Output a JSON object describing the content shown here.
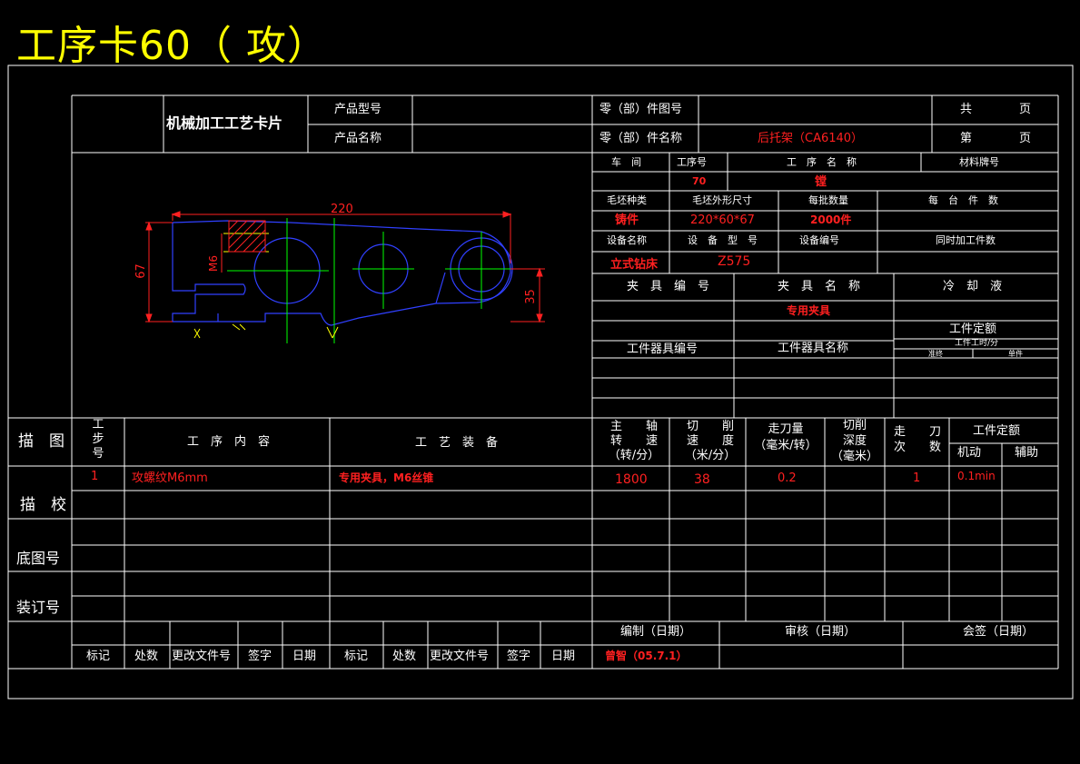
{
  "title": "工序卡60（ 攻）",
  "header": {
    "card_title": "机械加工工艺卡片",
    "product_model_label": "产品型号",
    "product_name_label": "产品名称",
    "part_no_label": "零（部）件图号",
    "part_name_label": "零（部）件名称",
    "part_name_value": "后托架（CA6140）",
    "total_label": "共",
    "page_label": "页",
    "sheet_label": "第",
    "sheet_page_label": "页"
  },
  "info": {
    "workshop_label": "车　间",
    "process_no_label": "工序号",
    "process_name_label": "工　序　名　称",
    "material_label": "材料牌号",
    "process_no_value": "70",
    "process_name_value": "镗",
    "blank_type_label": "毛坯种类",
    "blank_size_label": "毛坯外形尺寸",
    "batch_label": "每批数量",
    "per_unit_label": "每　台　件　数",
    "blank_type_value": "铸件",
    "blank_size_value": "220*60*67",
    "batch_value": "2000件",
    "equip_name_label": "设备名称",
    "equip_model_label": "设　备　型　号",
    "equip_no_label": "设备编号",
    "simul_label": "同时加工件数",
    "equip_name_value": "立式钻床",
    "equip_model_value": "Z575",
    "fixture_no_label": "夹　具　编　号",
    "fixture_name_label": "夹　具　名　称",
    "coolant_label": "冷　却　液",
    "fixture_name_value": "专用夹具",
    "quota_label": "工件定额",
    "tool_no_label": "工件器具编号",
    "tool_name_label": "工件器具名称",
    "time_label": "工件工时/分",
    "prep_label": "准终",
    "unit_label": "单件"
  },
  "drawing": {
    "dim_220": "220",
    "dim_67": "67",
    "dim_35": "35",
    "dim_m6": "M6"
  },
  "steps_header": {
    "sketch": "描　图",
    "step_no": "工步号",
    "content": "工　序　内　容",
    "equipment": "工　艺　装　备",
    "spindle": "主　　轴\n转　　速\n（转/分）",
    "cut_speed": "切　　削\n速　　度\n（米/分）",
    "feed": "走刀量\n（毫米/转）",
    "depth": "切削\n深度\n（毫米）",
    "passes": "走　　刀\n次　　数",
    "quota": "工件定额",
    "machine": "机动",
    "aux": "辅助"
  },
  "step1": {
    "no": "1",
    "content": "攻螺纹M6mm",
    "equipment": "专用夹具，M6丝锥",
    "spindle": "1800",
    "speed": "38",
    "feed": "0.2",
    "passes": "1",
    "machine": "0.1min"
  },
  "side": {
    "check": "描　校",
    "base_no": "底图号",
    "binding_no": "装订号"
  },
  "footer": {
    "compile": "编制（日期）",
    "review": "审核（日期）",
    "sign": "会签（日期）",
    "mark": "标记",
    "count": "处数",
    "change_doc": "更改文件号",
    "signature": "签字",
    "date": "日期",
    "compile_value": "曾智（05.7.1）"
  }
}
